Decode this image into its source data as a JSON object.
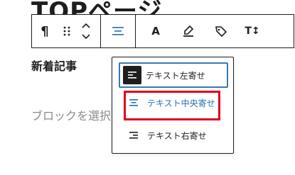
{
  "page": {
    "title": "TOPページ",
    "heading": "新着記事",
    "placeholder": "ブロックを選択するには「/」を入力"
  },
  "toolbar": {
    "paragraph_icon": "¶",
    "bold_label": "A",
    "text_size_label": "T↕"
  },
  "align_menu": {
    "items": [
      {
        "label": "テキスト左寄せ",
        "icon": "align-left-icon"
      },
      {
        "label": "テキスト中央寄せ",
        "icon": "align-center-icon"
      },
      {
        "label": "テキスト右寄せ",
        "icon": "align-right-icon"
      }
    ]
  },
  "colors": {
    "accent": "#2271b1",
    "highlight": "#e0001b",
    "text": "#1e1e1e",
    "placeholder": "#8a8a8a"
  }
}
